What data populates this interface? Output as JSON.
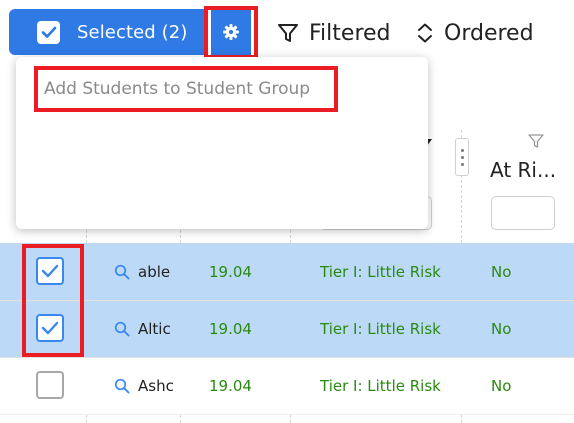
{
  "toolbar": {
    "selected_label": "Selected (2)",
    "filtered_label": "Filtered",
    "ordered_label": "Ordered"
  },
  "menu": {
    "items": [
      {
        "label": "Add Students to Student Group"
      }
    ]
  },
  "table": {
    "column_header_at_risk": "At Ri...",
    "rows": [
      {
        "checked": true,
        "name": "able",
        "score": "19.04",
        "tier": "Tier I: Little Risk",
        "at_risk": "No"
      },
      {
        "checked": true,
        "name": "Altic",
        "score": "19.04",
        "tier": "Tier I: Little Risk",
        "at_risk": "No"
      },
      {
        "checked": false,
        "name": "Ashc",
        "score": "19.04",
        "tier": "Tier I: Little Risk",
        "at_risk": "No"
      }
    ]
  },
  "colors": {
    "accent": "#2f7ae5",
    "selected_row": "#bcd9f7",
    "highlight_box": "#ec1c24",
    "value_green": "#2a8a10"
  }
}
